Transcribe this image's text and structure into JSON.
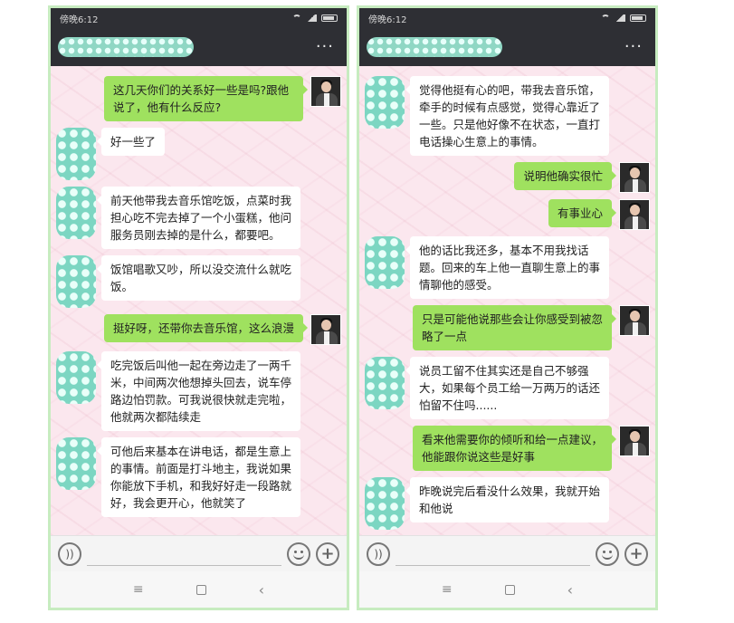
{
  "left": {
    "status_time": "傍晚6:12",
    "more_label": "···",
    "messages": [
      {
        "dir": "out",
        "text": "这几天你们的关系好一些是吗?跟他说了，他有什么反应?"
      },
      {
        "dir": "in",
        "text": "好一些了"
      },
      {
        "dir": "in",
        "text": "前天他带我去音乐馆吃饭，点菜时我担心吃不完去掉了一个小蛋糕，他问服务员刚去掉的是什么，都要吧。"
      },
      {
        "dir": "in",
        "text": "饭馆唱歌又吵，所以没交流什么就吃饭。"
      },
      {
        "dir": "out",
        "text": "挺好呀，还带你去音乐馆，这么浪漫"
      },
      {
        "dir": "in",
        "text": "吃完饭后叫他一起在旁边走了一两千米，中间两次他想掉头回去，说车停路边怕罚款。可我说很快就走完啦，他就两次都陆续走"
      },
      {
        "dir": "in",
        "text": "可他后来基本在讲电话，都是生意上的事情。前面是打斗地主，我说如果你能放下手机，和我好好走一段路就好，我会更开心，他就笑了"
      }
    ]
  },
  "right": {
    "status_time": "傍晚6:12",
    "more_label": "···",
    "messages": [
      {
        "dir": "in",
        "text": "觉得他挺有心的吧，带我去音乐馆，牵手的时候有点感觉，觉得心靠近了一些。只是他好像不在状态，一直打电话操心生意上的事情。"
      },
      {
        "dir": "out",
        "text": "说明他确实很忙"
      },
      {
        "dir": "out",
        "text": "有事业心"
      },
      {
        "dir": "in",
        "text": "他的话比我还多，基本不用我找话题。回来的车上他一直聊生意上的事情聊他的感受。"
      },
      {
        "dir": "out",
        "text": "只是可能他说那些会让你感受到被忽略了一点"
      },
      {
        "dir": "in",
        "text": "说员工留不住其实还是自己不够强大，如果每个员工给一万两万的话还怕留不住吗......"
      },
      {
        "dir": "out",
        "text": "看来他需要你的倾听和给一点建议，他能跟你说这些是好事"
      },
      {
        "dir": "in",
        "text": "昨晚说完后看没什么效果，我就开始和他说"
      }
    ]
  },
  "icons": {
    "voice": "voice-icon",
    "emoji": "emoji-icon",
    "plus": "plus-icon",
    "nav_menu": "≡",
    "nav_back": "‹"
  }
}
